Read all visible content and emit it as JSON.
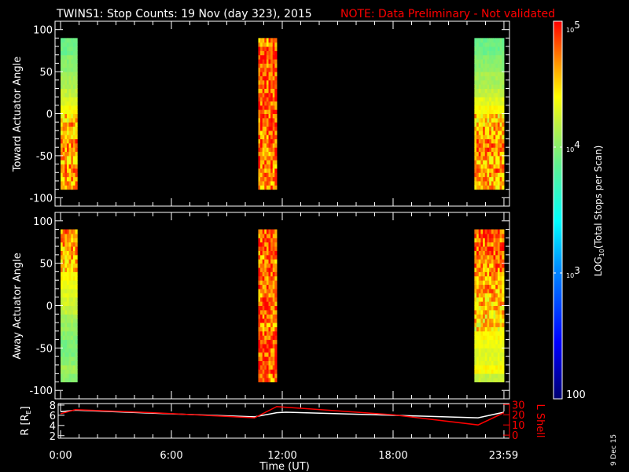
{
  "chart_data": [
    {
      "type": "heatmap",
      "title": "TWINS1: Stop Counts: 19 Nov (day 323), 2015",
      "note": "NOTE: Data Preliminary - Not validated",
      "ylabel": "Toward Actuator Angle",
      "ylim": [
        -110,
        110
      ],
      "yticks": [
        "100",
        "50",
        "0",
        "-50",
        "-100"
      ],
      "ytick_values": [
        100,
        50,
        0,
        -50,
        -100
      ],
      "angle_bins": [
        -90,
        90,
        10
      ],
      "blocks": [
        {
          "start_h": 0.0,
          "end_h": 0.9,
          "profile_log": [
            4.6,
            4.6,
            4.7,
            4.6,
            4.7,
            4.7,
            4.6,
            4.6,
            4.5,
            4.4,
            4.3,
            4.2,
            4.1,
            4.1,
            4.0,
            4.0,
            3.9,
            3.9
          ]
        },
        {
          "start_h": 10.7,
          "end_h": 11.7,
          "profile_log": [
            4.7,
            4.8,
            4.7,
            4.8,
            4.7,
            4.8,
            4.7,
            4.8,
            4.8,
            4.8,
            4.8,
            4.8,
            4.8,
            4.8,
            4.8,
            4.9,
            4.9,
            4.7
          ]
        },
        {
          "start_h": 22.4,
          "end_h": 24.0,
          "profile_log": [
            4.6,
            4.6,
            4.7,
            4.6,
            4.7,
            4.7,
            4.6,
            4.6,
            4.5,
            4.4,
            4.3,
            4.2,
            4.1,
            4.1,
            4.0,
            4.0,
            3.9,
            3.9
          ]
        }
      ]
    },
    {
      "type": "heatmap",
      "ylabel": "Away Actuator Angle",
      "ylim": [
        -110,
        110
      ],
      "yticks": [
        "100",
        "50",
        "0",
        "-50",
        "-100"
      ],
      "ytick_values": [
        100,
        50,
        0,
        -50,
        -100
      ],
      "angle_bins": [
        -90,
        90,
        10
      ],
      "blocks": [
        {
          "start_h": 0.0,
          "end_h": 0.9,
          "profile_log": [
            4.0,
            4.1,
            4.0,
            3.95,
            3.95,
            4.0,
            4.05,
            4.1,
            4.2,
            4.25,
            4.3,
            4.35,
            4.4,
            4.5,
            4.6,
            4.6,
            4.7,
            4.7
          ]
        },
        {
          "start_h": 10.7,
          "end_h": 11.7,
          "profile_log": [
            4.7,
            4.8,
            4.8,
            4.8,
            4.8,
            4.8,
            4.7,
            4.8,
            4.8,
            4.8,
            4.7,
            4.8,
            4.8,
            4.8,
            4.7,
            4.8,
            4.8,
            4.8
          ]
        },
        {
          "start_h": 22.4,
          "end_h": 24.0,
          "profile_log": [
            4.2,
            4.4,
            4.3,
            4.3,
            4.35,
            4.4,
            4.45,
            4.5,
            4.5,
            4.55,
            4.6,
            4.6,
            4.7,
            4.7,
            4.75,
            4.8,
            4.75,
            4.8
          ]
        }
      ]
    },
    {
      "type": "line",
      "ylabel": "R [R",
      "ylabel_sub": "E",
      "ylabel_close": "]",
      "y2label": "L Shell",
      "xlabel": "Time (UT)",
      "xlim": [
        -0.3,
        24.3
      ],
      "xticks": [
        "0:00",
        "6:00",
        "12:00",
        "18:00",
        "23:59"
      ],
      "xtick_values": [
        0,
        6,
        12,
        18,
        23.98
      ],
      "ylim": [
        1.5,
        8.3
      ],
      "yticks": [
        "8",
        "6",
        "4",
        "2"
      ],
      "ytick_values": [
        8,
        6,
        4,
        2
      ],
      "y2lim": [
        -3,
        31
      ],
      "y2ticks": [
        "30",
        "20",
        "10",
        "0"
      ],
      "y2tick_values": [
        30,
        20,
        10,
        0
      ],
      "series": [
        {
          "name": "R",
          "color": "#ffffff",
          "x": [
            0,
            0.8,
            5,
            10.5,
            11.7,
            12.2,
            18,
            22.6,
            24
          ],
          "y": [
            6.7,
            7.0,
            6.4,
            5.7,
            6.5,
            6.6,
            6.0,
            5.5,
            6.6
          ]
        },
        {
          "name": "L Shell",
          "color": "#ff0000",
          "axis": "right",
          "x": [
            0,
            0.8,
            5,
            10.5,
            11.7,
            18,
            22.6,
            24
          ],
          "y": [
            21,
            25,
            22,
            17,
            28,
            20,
            10,
            22
          ]
        }
      ]
    }
  ],
  "colorbar": {
    "label_main": "LOG",
    "label_sub": "10",
    "label_rest": "(Total Stops per Scan)",
    "tick_labels": [
      "10",
      "10",
      "10",
      "100"
    ],
    "tick_exps": [
      "5",
      "4",
      "3",
      ""
    ],
    "tick_values_log": [
      5,
      4,
      3,
      2
    ]
  },
  "date_stamp": "9 Dec 15",
  "colors": {
    "note": "#ff0000",
    "lshell": "#ff0000",
    "axis": "#ffffff"
  }
}
